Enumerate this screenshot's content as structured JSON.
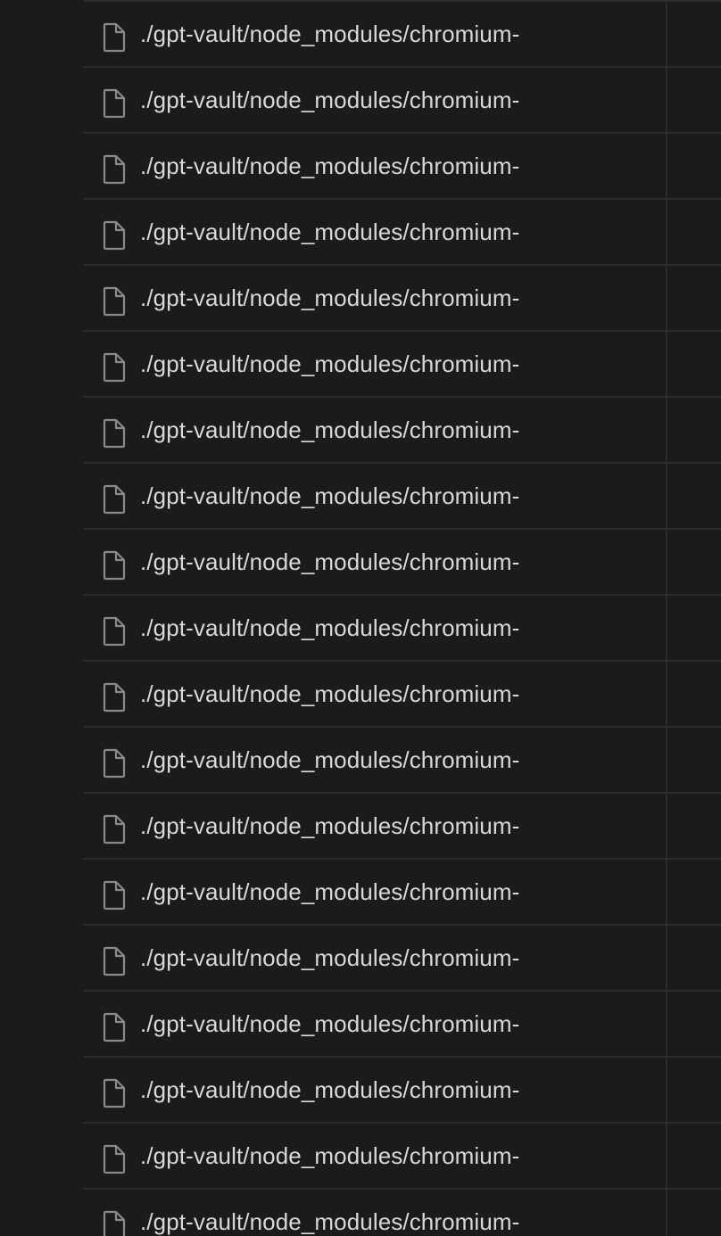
{
  "file_list": {
    "rows": [
      {
        "name": "./gpt-vault/node_modules/chromium-",
        "icon": "file-icon"
      },
      {
        "name": "./gpt-vault/node_modules/chromium-",
        "icon": "file-icon"
      },
      {
        "name": "./gpt-vault/node_modules/chromium-",
        "icon": "file-icon"
      },
      {
        "name": "./gpt-vault/node_modules/chromium-",
        "icon": "file-icon"
      },
      {
        "name": "./gpt-vault/node_modules/chromium-",
        "icon": "file-icon"
      },
      {
        "name": "./gpt-vault/node_modules/chromium-",
        "icon": "file-icon"
      },
      {
        "name": "./gpt-vault/node_modules/chromium-",
        "icon": "file-icon"
      },
      {
        "name": "./gpt-vault/node_modules/chromium-",
        "icon": "file-icon"
      },
      {
        "name": "./gpt-vault/node_modules/chromium-",
        "icon": "file-icon"
      },
      {
        "name": "./gpt-vault/node_modules/chromium-",
        "icon": "file-icon"
      },
      {
        "name": "./gpt-vault/node_modules/chromium-",
        "icon": "file-icon"
      },
      {
        "name": "./gpt-vault/node_modules/chromium-",
        "icon": "file-icon"
      },
      {
        "name": "./gpt-vault/node_modules/chromium-",
        "icon": "file-icon"
      },
      {
        "name": "./gpt-vault/node_modules/chromium-",
        "icon": "file-icon"
      },
      {
        "name": "./gpt-vault/node_modules/chromium-",
        "icon": "file-icon"
      },
      {
        "name": "./gpt-vault/node_modules/chromium-",
        "icon": "file-icon"
      },
      {
        "name": "./gpt-vault/node_modules/chromium-",
        "icon": "file-icon"
      },
      {
        "name": "./gpt-vault/node_modules/chromium-",
        "icon": "file-icon"
      },
      {
        "name": "./gpt-vault/node_modules/chromium-",
        "icon": "file-icon"
      }
    ]
  },
  "colors": {
    "background": "#1b1b1b",
    "row_border": "#2c2c2c",
    "text": "#d8d8d8",
    "icon": "#8a8a8a"
  }
}
